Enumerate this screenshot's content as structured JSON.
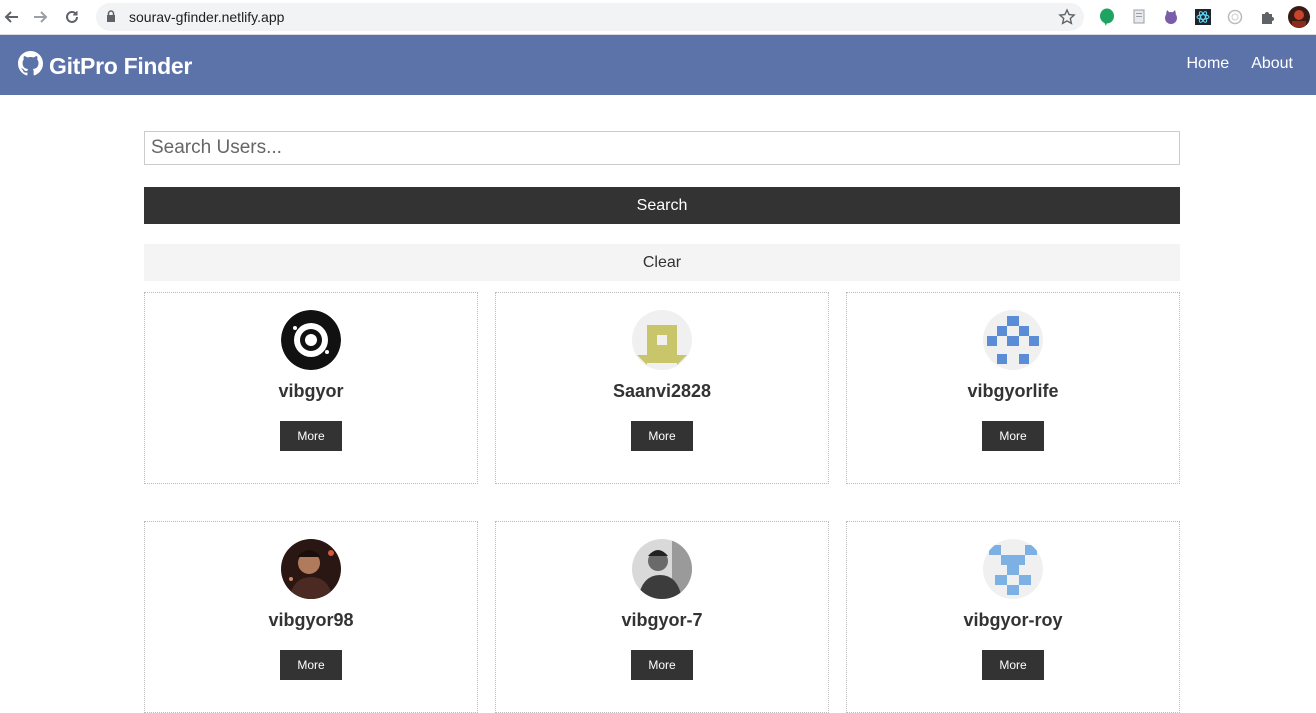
{
  "browser": {
    "url": "sourav-gfinder.netlify.app"
  },
  "navbar": {
    "title": "GitPro Finder",
    "links": [
      "Home",
      "About"
    ],
    "bg_color": "#5c73aa"
  },
  "search": {
    "placeholder": "Search Users...",
    "value": "",
    "search_label": "Search",
    "clear_label": "Clear"
  },
  "users": [
    {
      "login": "vibgyor",
      "more_label": "More",
      "avatar": "black-ring-avatar"
    },
    {
      "login": "Saanvi2828",
      "more_label": "More",
      "avatar": "olive-identicon-avatar"
    },
    {
      "login": "vibgyorlife",
      "more_label": "More",
      "avatar": "blue-identicon-avatar"
    },
    {
      "login": "vibgyor98",
      "more_label": "More",
      "avatar": "photo-avatar"
    },
    {
      "login": "vibgyor-7",
      "more_label": "More",
      "avatar": "grayscale-photo-avatar"
    },
    {
      "login": "vibgyor-roy",
      "more_label": "More",
      "avatar": "lightblue-identicon-avatar"
    }
  ]
}
